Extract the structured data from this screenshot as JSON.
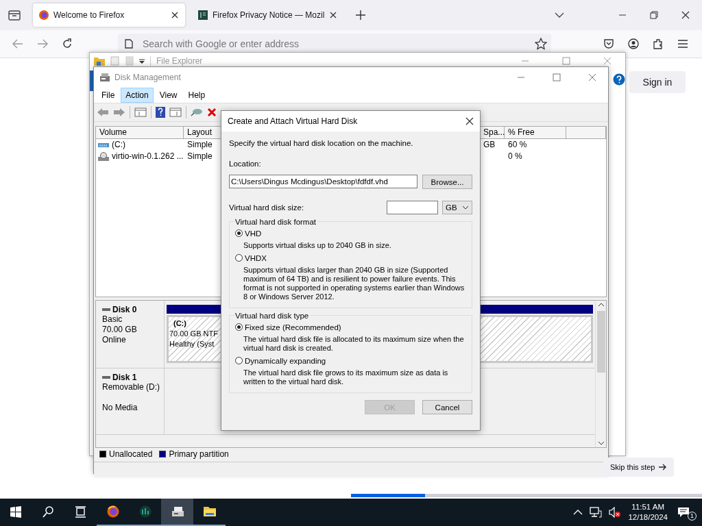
{
  "browser": {
    "tabs": [
      {
        "title": "Welcome to Firefox",
        "kind": "firefox",
        "selected": true
      },
      {
        "title": "Firefox Privacy Notice — Mozil",
        "kind": "document",
        "selected": false
      }
    ],
    "address_bar": {
      "placeholder": "Search with Google or enter address"
    },
    "sign_in": "Sign in",
    "skip": "Skip this step",
    "progress": {
      "level": 0.21
    }
  },
  "file_explorer": {
    "title": "File Explorer"
  },
  "disk_management": {
    "title": "Disk Management",
    "menu": [
      {
        "label": "File",
        "selected": false
      },
      {
        "label": "Action",
        "selected": true
      },
      {
        "label": "View",
        "selected": false
      },
      {
        "label": "Help",
        "selected": false
      }
    ],
    "volumes": {
      "columns": [
        "Volume",
        "Layout",
        "Spa...",
        "% Free"
      ],
      "rows": [
        {
          "kind": "disk",
          "volume": "(C:)",
          "layout": "Simple",
          "column_3": "GB",
          "free": "60 %"
        },
        {
          "kind": "cd",
          "volume": "virtio-win-0.1.262 ...",
          "layout": "Simple",
          "free": "0 %"
        }
      ]
    },
    "disks": [
      {
        "name": "Disk 0",
        "type": "Basic",
        "size": "70.00 GB",
        "status": "Online",
        "partition": {
          "label": "(C:)",
          "lines": [
            "70.00 GB NTF",
            "Healthy (Syst"
          ]
        }
      },
      {
        "name": "Disk 1",
        "type": "Removable (D:)",
        "status": "No Media"
      }
    ],
    "legend": [
      {
        "label": "Unallocated",
        "color": "#000000"
      },
      {
        "label": "Primary partition",
        "color": "#000080"
      }
    ]
  },
  "dialog": {
    "title": "Create and Attach Virtual Hard Disk",
    "intro": "Specify the virtual hard disk location on the machine.",
    "location_label": "Location:",
    "location": "C:\\Users\\Dingus Mcdingus\\Desktop\\fdfdf.vhd",
    "browse": "Browse...",
    "size_label": "Virtual hard disk size:",
    "unit": "GB",
    "groups": [
      {
        "legend": "Virtual hard disk format",
        "options": [
          {
            "label": "VHD",
            "description": "Supports virtual disks up to 2040 GB in size.",
            "selected": true
          },
          {
            "label": "VHDX",
            "description": "Supports virtual disks larger than 2040 GB in size (Supported maximum of 64 TB) and is resilient to power failure events. This format is not supported in operating systems earlier than Windows 8 or Windows Server 2012.",
            "selected": false
          }
        ]
      },
      {
        "legend": "Virtual hard disk type",
        "options": [
          {
            "label": "Fixed size (Recommended)",
            "description": "The virtual hard disk file is allocated to its maximum size when the virtual hard disk is created.",
            "selected": true
          },
          {
            "label": "Dynamically expanding",
            "description": "The virtual hard disk file grows to its maximum size as data is written to the virtual hard disk.",
            "selected": false
          }
        ]
      }
    ],
    "buttons": [
      {
        "label": "OK",
        "disabled": true
      },
      {
        "label": "Cancel",
        "disabled": false
      }
    ]
  },
  "taskbar": {
    "apps": [
      {
        "kind": "start",
        "running": false,
        "active": false
      },
      {
        "kind": "search",
        "running": false,
        "active": false
      },
      {
        "kind": "taskview",
        "running": false,
        "active": false
      },
      {
        "kind": "firefox",
        "running": true,
        "active": false
      },
      {
        "kind": "chart-app",
        "running": true,
        "active": false
      },
      {
        "kind": "disk",
        "running": true,
        "active": true
      },
      {
        "kind": "folder",
        "running": true,
        "active": false
      }
    ],
    "time": "11:51 AM",
    "date": "12/18/2024",
    "notifications": "1"
  }
}
